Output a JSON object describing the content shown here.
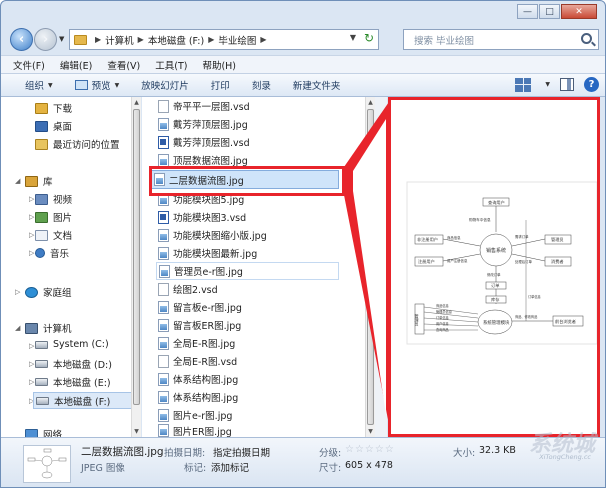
{
  "window": {
    "caption_buttons": [
      "—",
      "□",
      "✕"
    ]
  },
  "address": {
    "crumbs": [
      "计算机",
      "本地磁盘 (F:)",
      "毕业绘图"
    ],
    "search_placeholder": "搜索 毕业绘图"
  },
  "menubar": [
    "文件(F)",
    "编辑(E)",
    "查看(V)",
    "工具(T)",
    "帮助(H)"
  ],
  "toolbar": {
    "organize": "组织",
    "preview": "预览",
    "slideshow": "放映幻灯片",
    "print": "打印",
    "burn": "刻录",
    "new_folder": "新建文件夹"
  },
  "nav": {
    "downloads": "下载",
    "desktop": "桌面",
    "recent": "最近访问的位置",
    "library": "库",
    "video": "视频",
    "pictures": "图片",
    "documents": "文档",
    "music": "音乐",
    "homegroup": "家庭组",
    "computer": "计算机",
    "drive_c": "System (C:)",
    "drive_d": "本地磁盘 (D:)",
    "drive_e": "本地磁盘 (E:)",
    "drive_f": "本地磁盘 (F:)",
    "network": "网络"
  },
  "files": [
    {
      "name": "帝平平一层图.vsd",
      "type": "blank"
    },
    {
      "name": "戴芳萍顶层图.jpg",
      "type": "jpg"
    },
    {
      "name": "戴芳萍顶层图.vsd",
      "type": "vsd"
    },
    {
      "name": "顶层数据流图.jpg",
      "type": "jpg"
    },
    {
      "name": "二层数据流图.jpg",
      "type": "jpg"
    },
    {
      "name": "功能模块图5.jpg",
      "type": "jpg"
    },
    {
      "name": "功能模块图3.vsd",
      "type": "vsd"
    },
    {
      "name": "功能模块图缩小版.jpg",
      "type": "jpg"
    },
    {
      "name": "功能模块图最新.jpg",
      "type": "jpg"
    },
    {
      "name": "管理员e-r图.jpg",
      "type": "jpg"
    },
    {
      "name": "绘图2.vsd",
      "type": "blank"
    },
    {
      "name": "留言板e-r图.jpg",
      "type": "jpg"
    },
    {
      "name": "留言板ER图.jpg",
      "type": "jpg"
    },
    {
      "name": "全局E-R图.jpg",
      "type": "jpg"
    },
    {
      "name": "全局E-R图.vsd",
      "type": "blank"
    },
    {
      "name": "体系结构图.jpg",
      "type": "jpg"
    },
    {
      "name": "体系结构图.jpg",
      "type": "jpg"
    },
    {
      "name": "图片e-r图.jpg",
      "type": "jpg"
    },
    {
      "name": "图片ER图.jpg",
      "type": "jpg"
    }
  ],
  "diagram": {
    "nodes": [
      "查询用户",
      "非注册用户",
      "注册用户",
      "销售系统",
      "管理员",
      "消费者",
      "订单",
      "库存",
      "管理员",
      "系统管理模块",
      "前台浏览者"
    ],
    "labels": [
      "购物车中信息",
      "用户注册信息",
      "商品信息",
      "订单信息",
      "需求订单",
      "处理后订单",
      "商品、修改商品",
      "商品信息",
      "管理员信息",
      "订单信息",
      "用户信息",
      "查询商品",
      "修改订单"
    ]
  },
  "details": {
    "filename": "二层数据流图.jpg",
    "filetype": "JPEG 图像",
    "date_label": "拍摄日期:",
    "date_value": "指定拍摄日期",
    "tag_label": "标记:",
    "tag_value": "添加标记",
    "rating_label": "分级:",
    "stars": "☆☆☆☆☆",
    "size_label": "大小:",
    "size_value": "32.3 KB",
    "dims_label": "尺寸:",
    "dims_value": "605 x 478"
  },
  "watermark": {
    "text": "系统城",
    "sub": "XiTongCheng.cc"
  },
  "colors": {
    "highlight": "#e8242b",
    "selection": "#cfe4fa"
  }
}
